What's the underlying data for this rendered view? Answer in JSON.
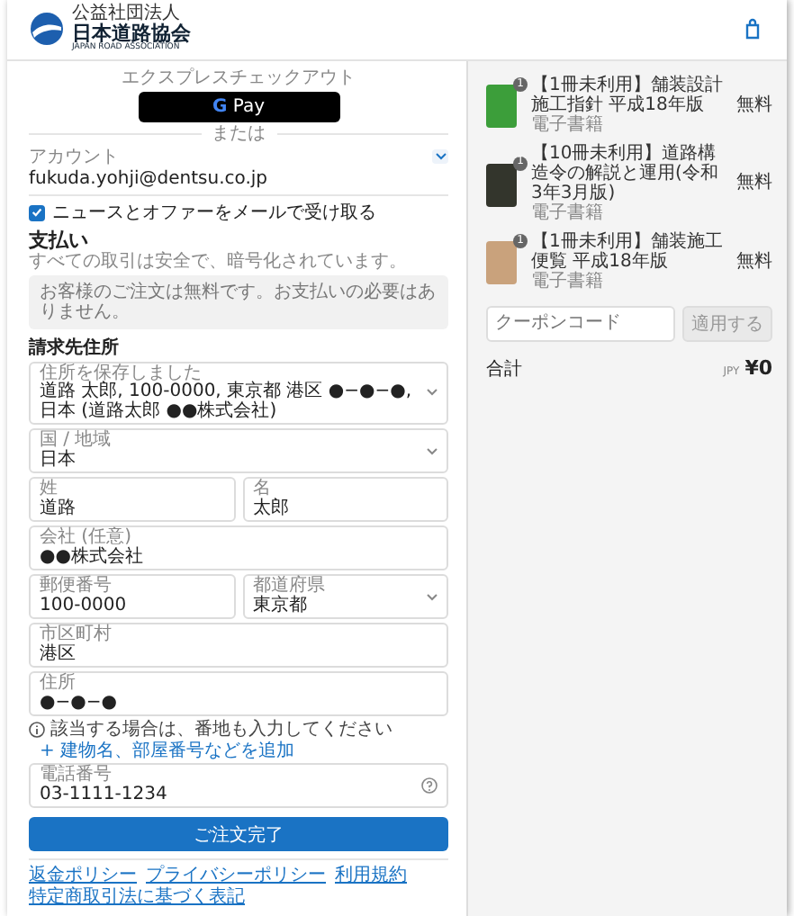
{
  "header": {
    "logo": {
      "org_type": "公益社団法人",
      "name": "日本道路協会",
      "english": "JAPAN ROAD ASSOCIATION"
    }
  },
  "express": {
    "label": "エクスプレスチェックアウト",
    "gpay_mark": "G",
    "gpay_label": "Pay",
    "divider": "または"
  },
  "account": {
    "label": "アカウント",
    "email": "fukuda.yohji@dentsu.co.jp"
  },
  "newsletter": {
    "label": "ニュースとオファーをメールで受け取る",
    "checked": true
  },
  "payment": {
    "title": "支払い",
    "subtitle": "すべての取引は安全で、暗号化されています。",
    "notice": "お客様のご注文は無料です。お支払いの必要はありません。"
  },
  "billing": {
    "title": "請求先住所",
    "rows": [
      [
        {
          "kind": "select",
          "label": "住所を保存しました",
          "value": "道路 太郎, 100-0000, 東京都 港区 ●−●−●, 日本 (道路太郎 ●●株式会社)"
        }
      ],
      [
        {
          "kind": "select",
          "label": "国 / 地域",
          "value": "日本"
        }
      ],
      [
        {
          "kind": "text",
          "label": "姓",
          "value": "道路"
        },
        {
          "kind": "text",
          "label": "名",
          "value": "太郎"
        }
      ],
      [
        {
          "kind": "text",
          "label": "会社 (任意)",
          "value": "●●株式会社"
        }
      ],
      [
        {
          "kind": "text",
          "label": "郵便番号",
          "value": "100-0000"
        },
        {
          "kind": "select",
          "label": "都道府県",
          "value": "東京都"
        }
      ],
      [
        {
          "kind": "text",
          "label": "市区町村",
          "value": "港区"
        }
      ],
      [
        {
          "kind": "text",
          "label": "住所",
          "value": "●−●−●"
        }
      ]
    ],
    "hint": "該当する場合は、番地も入力してください",
    "add_link": "+ 建物名、部屋番号などを追加",
    "phone": {
      "kind": "help",
      "label": "電話番号",
      "value": "03-1111-1234"
    }
  },
  "submit": "ご注文完了",
  "footer_links": [
    "返金ポリシー",
    "プライバシーポリシー",
    "利用規約",
    "特定商取引法に基づく表記"
  ],
  "order": {
    "items": [
      {
        "title": "【1冊未利用】舗装設計施工指針 平成18年版",
        "subtitle": "電子書籍",
        "price": "無料",
        "quantity": "1",
        "color": "#3c9e3a"
      },
      {
        "title": "【10冊未利用】道路構造令の解説と運用(令和3年3月版)",
        "subtitle": "電子書籍",
        "price": "無料",
        "quantity": "1",
        "color": "#33352c"
      },
      {
        "title": "【1冊未利用】舗装施工便覧 平成18年版",
        "subtitle": "電子書籍",
        "price": "無料",
        "quantity": "1",
        "color": "#c9a27c"
      }
    ],
    "coupon": {
      "placeholder": "クーポンコード",
      "button": "適用する",
      "disabled": true
    },
    "total": {
      "label": "合計",
      "currency": "JPY",
      "amount": "¥0"
    }
  }
}
